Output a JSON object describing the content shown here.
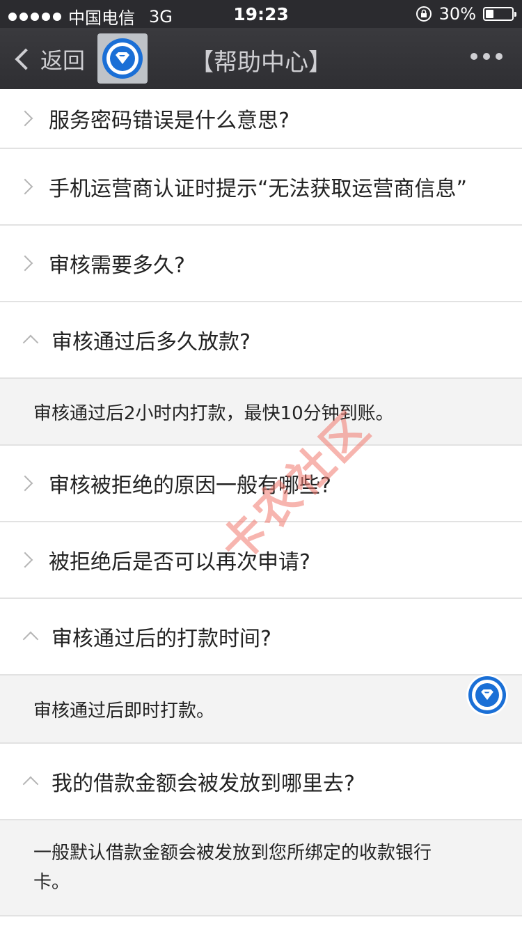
{
  "status_bar": {
    "carrier": "中国电信",
    "network": "3G",
    "time": "19:23",
    "battery": "30%",
    "battery_level": 0.3
  },
  "nav": {
    "back_label": "返回",
    "title": "【帮助中心】",
    "logo_icon": "superman-shield-icon",
    "more_icon": "more-dots-icon"
  },
  "faq": {
    "items": [
      {
        "question": "服务密码错误是什么意思?",
        "expanded": false
      },
      {
        "question": "手机运营商认证时提示“无法获取运营商信息”",
        "expanded": false
      },
      {
        "question": "审核需要多久?",
        "expanded": false
      },
      {
        "question": "审核通过后多久放款?",
        "expanded": true,
        "answer": "审核通过后2小时内打款，最快10分钟到账。"
      },
      {
        "question": "审核被拒绝的原因一般有哪些?",
        "expanded": false
      },
      {
        "question": "被拒绝后是否可以再次申请?",
        "expanded": false
      },
      {
        "question": "审核通过后的打款时间?",
        "expanded": true,
        "answer": "审核通过后即时打款。"
      },
      {
        "question": "我的借款金额会被发放到哪里去?",
        "expanded": true,
        "answer": "一般默认借款金额会被发放到您所绑定的收款银行卡。"
      }
    ]
  },
  "watermark": {
    "text": "卡农社区"
  },
  "colors": {
    "accent": "#1a6fd6",
    "navbar": "#2f2f33",
    "answer_bg": "#f3f3f3",
    "watermark": "#f0786e"
  }
}
